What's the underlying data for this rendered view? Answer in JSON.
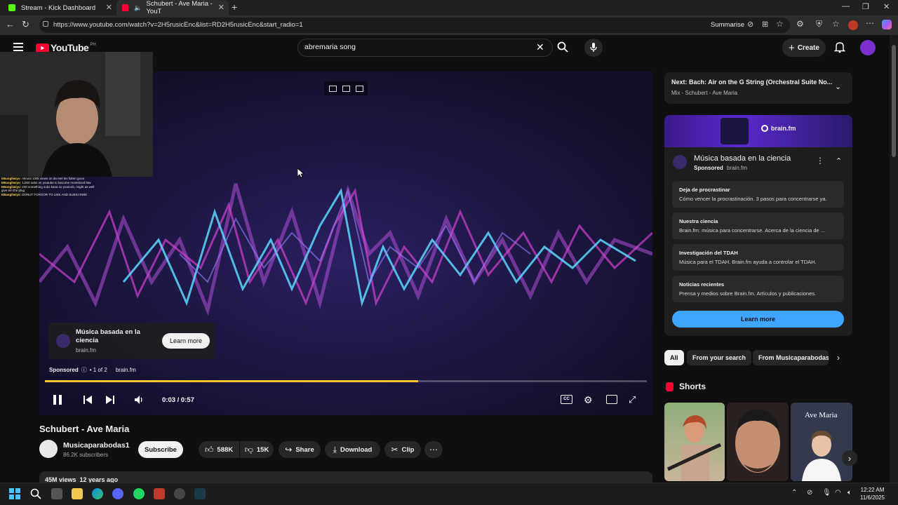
{
  "browser": {
    "tabs": [
      {
        "label": "Stream - Kick Dashboard",
        "icon": "kick-icon",
        "active": false
      },
      {
        "label": "Schubert - Ave Maria - YouT",
        "icon": "youtube-icon",
        "active": true
      }
    ],
    "url": "https://www.youtube.com/watch?v=2H5rusicEnc&list=RD2H5rusicEnc&start_radio=1",
    "summarise_label": "Summarise"
  },
  "youtube": {
    "logo_text": "YouTube",
    "country": "PH",
    "search_value": "abremaria song",
    "create_label": "Create"
  },
  "stream_chat": [
    {
      "user": "EBangliwiyo",
      "text": ": Almost 100k views on da reel les foken gooo"
    },
    {
      "user": "EBangliwiyo",
      "text": ": 1,000 subs on youtube to become monetized btw"
    },
    {
      "user": "EBangliwiyo",
      "text": ": 230 something subs kana so youtoob, might as well give em the plug"
    },
    {
      "user": "EBangliwiyo",
      "text": ": DONUT FORGOR TO LIEK AND SUBSCRIBE"
    }
  ],
  "player": {
    "ad_title": "Música basada en la ciencia",
    "ad_domain": "brain.fm",
    "ad_cta": "Learn more",
    "sponsored": "Sponsored",
    "ad_count": "• 1 of 2",
    "ad_site": "brain.fm",
    "time": "0:03 / 0:57",
    "progress": 0.62
  },
  "video": {
    "title": "Schubert - Ave Maria",
    "channel": "Musicaparabodas1",
    "subscribers": "86.2K subscribers",
    "subscribe_label": "Subscribe",
    "likes": "588K",
    "dislikes": "15K",
    "share": "Share",
    "download": "Download",
    "clip": "Clip",
    "meta": "45M views  12 years ago"
  },
  "sidebar": {
    "next_label": "Next:",
    "next_title": "Bach: Air on the G String (Orchestral Suite No...",
    "next_sub": "Mix - Schubert - Ave Maria",
    "ad_brand": "brain.fm",
    "ad_title": "Música basada en la ciencia",
    "ad_sponsored": "Sponsored",
    "ad_domain": "brain.fm",
    "ad_links": [
      {
        "title": "Deja de procrastinar",
        "desc": "Cómo vencer la procrastinación. 3 pasos para concentrarse ya."
      },
      {
        "title": "Nuestra ciencia",
        "desc": "Brain.fm: música para concentrarse. Acerca de la ciencia de ..."
      },
      {
        "title": "Investigación del TDAH",
        "desc": "Música para el TDAH. Brain.fm ayuda a controlar el TDAH."
      },
      {
        "title": "Noticias recientes",
        "desc": "Prensa y medios sobre Brain.fm. Artículos y publicaciones."
      }
    ],
    "learn_more": "Learn more",
    "chips": [
      "All",
      "From your search",
      "From Musicaparabodas"
    ],
    "shorts_title": "Shorts",
    "short_overlay_text": "Ave Maria"
  },
  "taskbar": {
    "time": "12:22 AM",
    "date": "11/6/2025"
  },
  "colors": {
    "accent_blue": "#3ea6ff",
    "progress_yellow": "#fbc530",
    "youtube_red": "#ff0033",
    "kick_green": "#53fc18"
  }
}
